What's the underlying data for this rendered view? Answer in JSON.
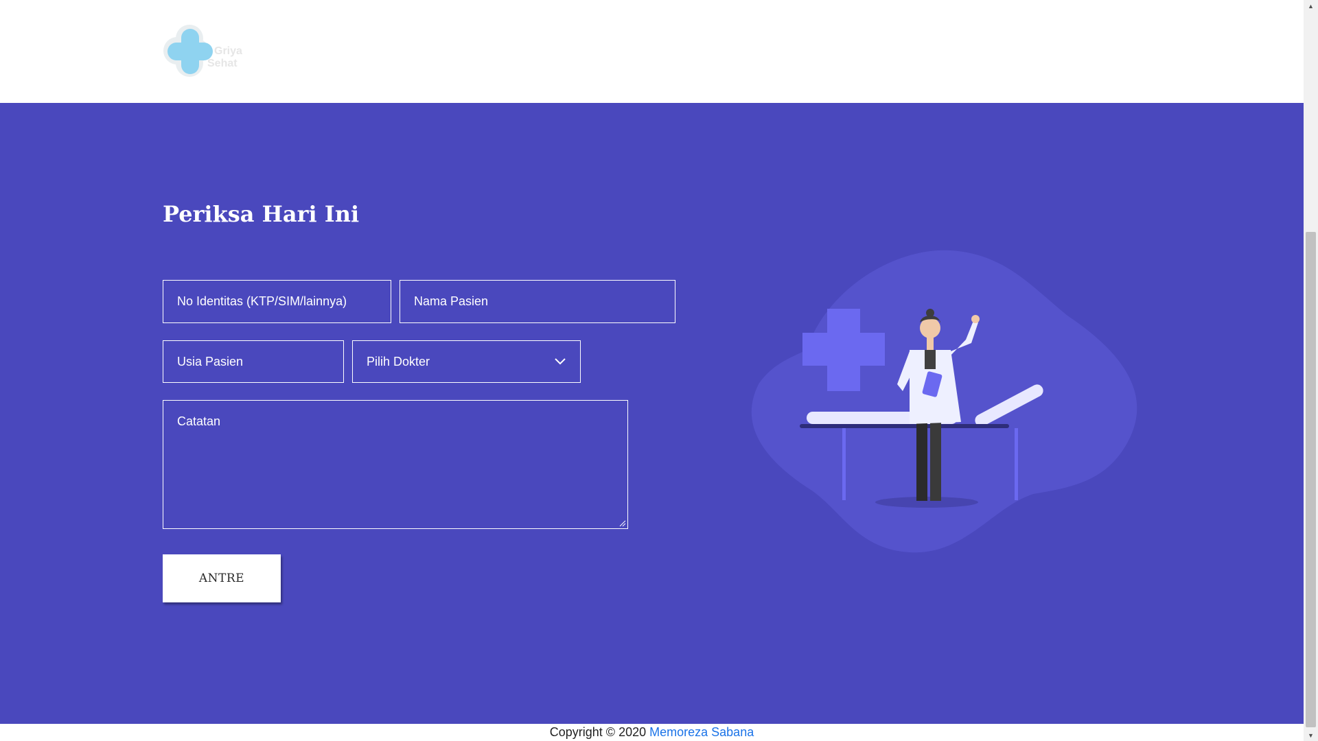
{
  "brand": {
    "line1": "Griya",
    "line2": "Sehat"
  },
  "form": {
    "title": "Periksa Hari Ini",
    "id_placeholder": "No Identitas (KTP/SIM/lainnya)",
    "name_placeholder": "Nama Pasien",
    "age_placeholder": "Usia Pasien",
    "doctor_select": "Pilih Dokter",
    "notes_placeholder": "Catatan",
    "submit_label": "ANTRE"
  },
  "footer": {
    "copyright": "Copyright © 2020",
    "author": "Memoreza Sabana"
  },
  "colors": {
    "hero_bg": "#4a48bd",
    "logo_cross": "#8fd3f0",
    "link": "#1a73e8"
  },
  "icons": {
    "logo": "medical-cross-icon",
    "select": "chevron-down-icon",
    "scroll_up": "arrow-up-icon",
    "scroll_down": "arrow-down-icon"
  }
}
